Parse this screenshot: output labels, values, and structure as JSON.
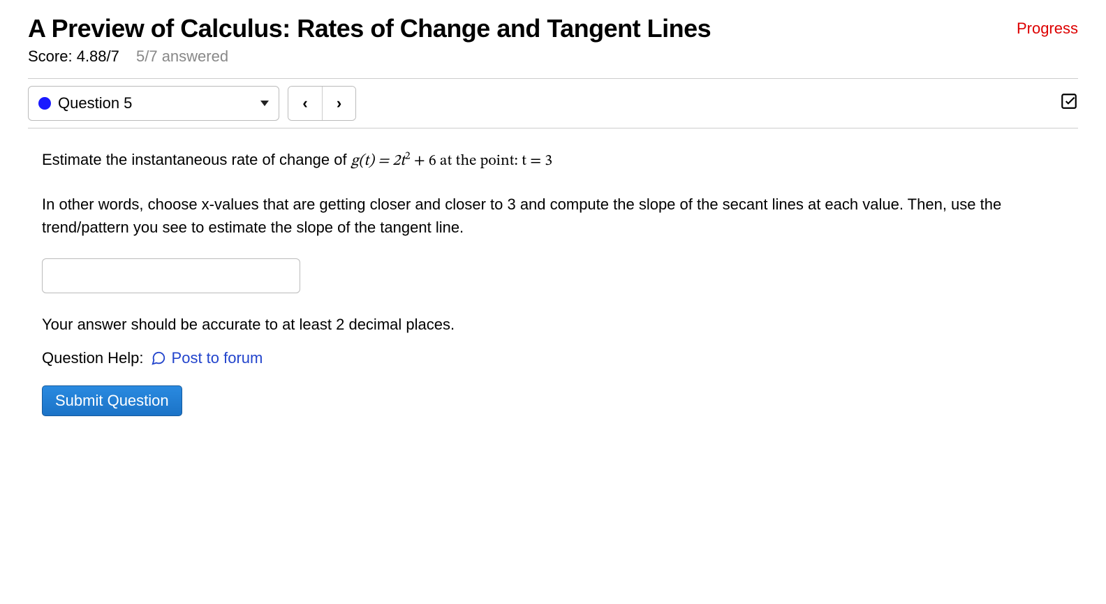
{
  "header": {
    "title": "A Preview of Calculus: Rates of Change and Tangent Lines",
    "progress_label": "Progress",
    "score_prefix": "Score: ",
    "score_value": "4.88/7",
    "answered": "5/7 answered"
  },
  "nav": {
    "question_label": "Question 5",
    "prev_glyph": "‹",
    "next_glyph": "›"
  },
  "question": {
    "line1_pre": "Estimate the instantaneous rate of change of ",
    "line1_fn": "g(t) = 2t",
    "line1_exp": "2",
    "line1_post": " + 6 at the point: t = 3",
    "line2": "In other words, choose x-values that are getting closer and closer to 3 and compute the slope of the secant lines at each value. Then, use the trend/pattern you see to estimate the slope of the tangent line.",
    "accuracy_hint": "Your answer should be accurate to at least 2 decimal places.",
    "help_label": "Question Help:",
    "forum_link": "Post to forum",
    "submit_label": "Submit Question"
  }
}
